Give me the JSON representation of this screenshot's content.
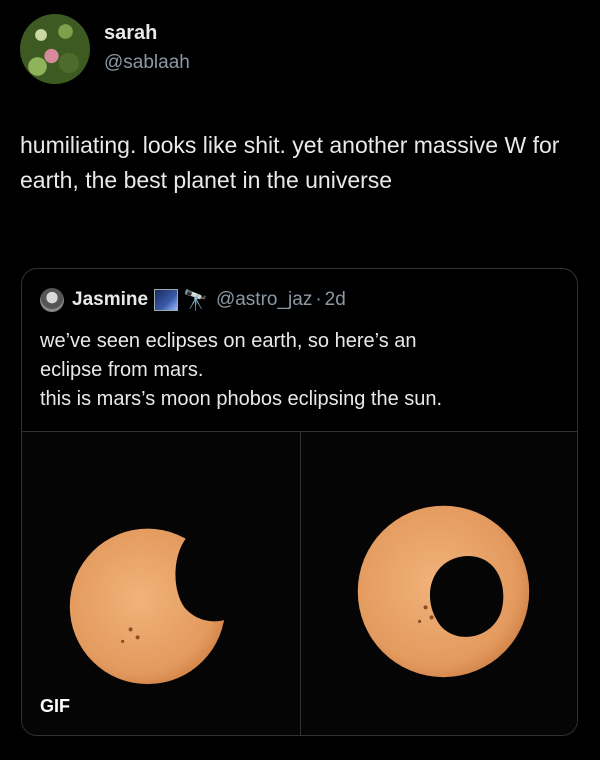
{
  "tweet": {
    "author_name": "sarah",
    "author_handle": "@sablaah",
    "text": "humiliating. looks like shit. yet another massive W for earth, the best planet in the universe"
  },
  "quoted": {
    "author_name": "Jasmine",
    "author_handle": "@astro_jaz",
    "separator": "·",
    "time": "2d",
    "emoji_scope": "🔭",
    "text_lines": [
      "we’ve seen eclipses on earth, so here’s an",
      "eclipse from mars.",
      "this is mars’s moon phobos eclipsing the sun."
    ],
    "media_badge": "GIF"
  },
  "colors": {
    "background": "#000000",
    "text": "#e7e9ea",
    "secondary": "#8b98a5",
    "border": "#2f3336",
    "sun": "#e9a46a"
  }
}
